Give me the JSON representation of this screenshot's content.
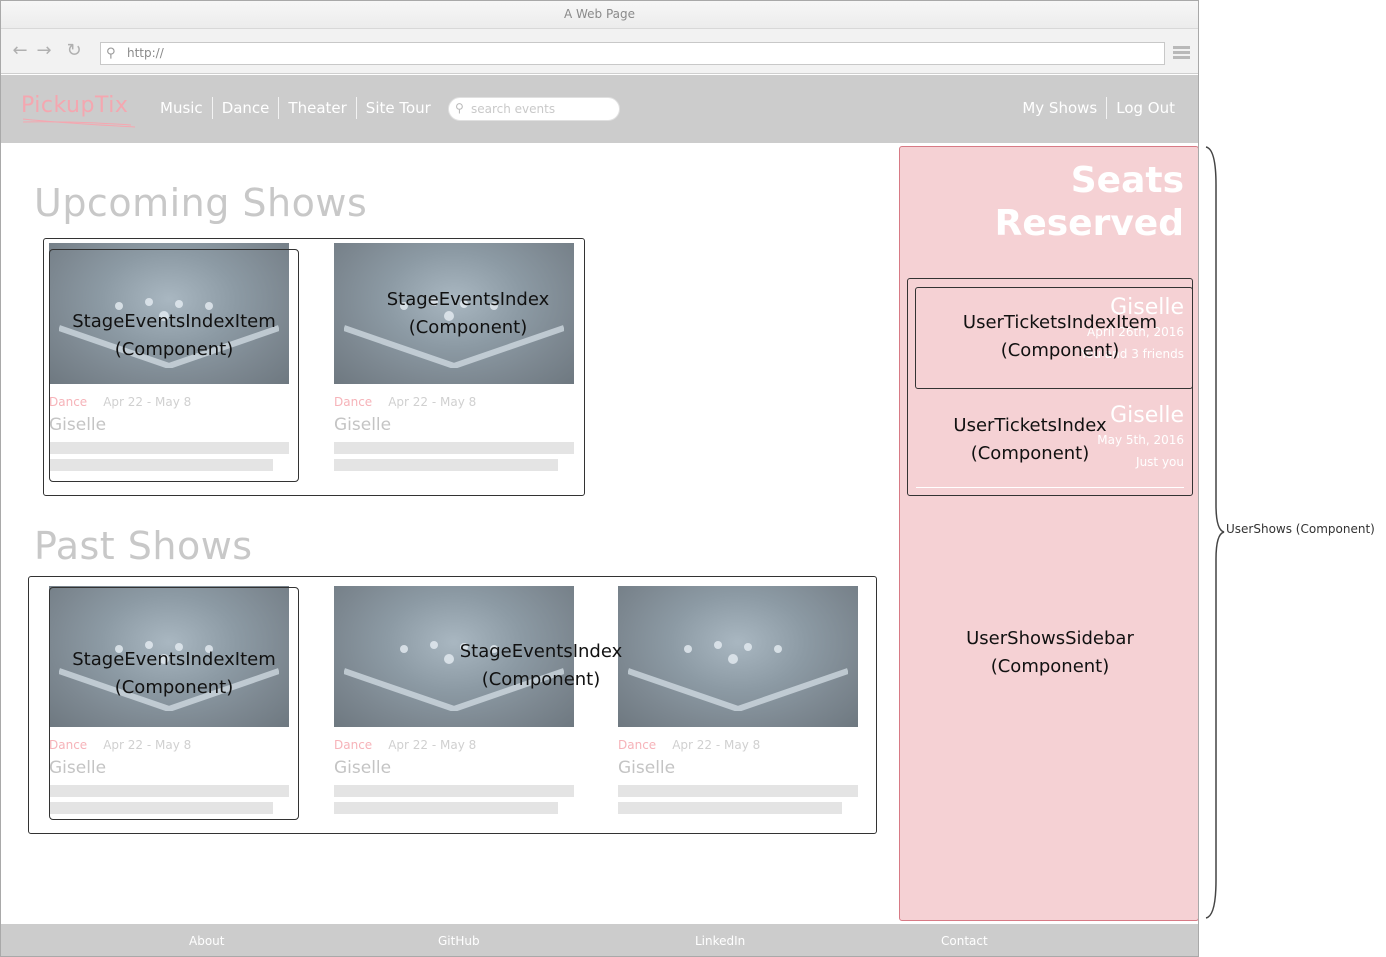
{
  "window": {
    "title": "A Web Page",
    "url": "http://"
  },
  "site": {
    "logo": "PickupTix",
    "nav": [
      "Music",
      "Dance",
      "Theater",
      "Site Tour"
    ],
    "search_placeholder": "search events",
    "user_nav": [
      "My Shows",
      "Log Out"
    ]
  },
  "upcoming": {
    "title": "Upcoming Shows",
    "cards": [
      {
        "category": "Dance",
        "dates": "Apr 22 - May 8",
        "name": "Giselle"
      },
      {
        "category": "Dance",
        "dates": "Apr 22 - May 8",
        "name": "Giselle"
      }
    ],
    "item_label": [
      "StageEventsIndexItem",
      "(Component)"
    ],
    "index_label": [
      "StageEventsIndex",
      "(Component)"
    ]
  },
  "past": {
    "title": "Past Shows",
    "cards": [
      {
        "category": "Dance",
        "dates": "Apr 22 - May 8",
        "name": "Giselle"
      },
      {
        "category": "Dance",
        "dates": "Apr 22 - May 8",
        "name": "Giselle"
      },
      {
        "category": "Dance",
        "dates": "Apr 22 - May 8",
        "name": "Giselle"
      }
    ],
    "item_label": [
      "StageEventsIndexItem",
      "(Component)"
    ],
    "index_label": [
      "StageEventsIndex",
      "(Component)"
    ]
  },
  "sidebar": {
    "title": [
      "Seats",
      "Reserved"
    ],
    "tickets": [
      {
        "name": "Giselle",
        "date": "April 26th, 2016",
        "who": "You and 3 friends"
      },
      {
        "name": "Giselle",
        "date": "May 5th, 2016",
        "who": "Just you"
      }
    ],
    "ticket_item_label": [
      "UserTicketsIndexItem",
      "(Component)"
    ],
    "tickets_index_label": [
      "UserTicketsIndex",
      "(Component)"
    ],
    "sidebar_label": [
      "UserShowsSidebar",
      "(Component)"
    ]
  },
  "annotation": "UserShows (Component)",
  "footer": [
    "About",
    "GitHub",
    "LinkedIn",
    "Contact"
  ]
}
